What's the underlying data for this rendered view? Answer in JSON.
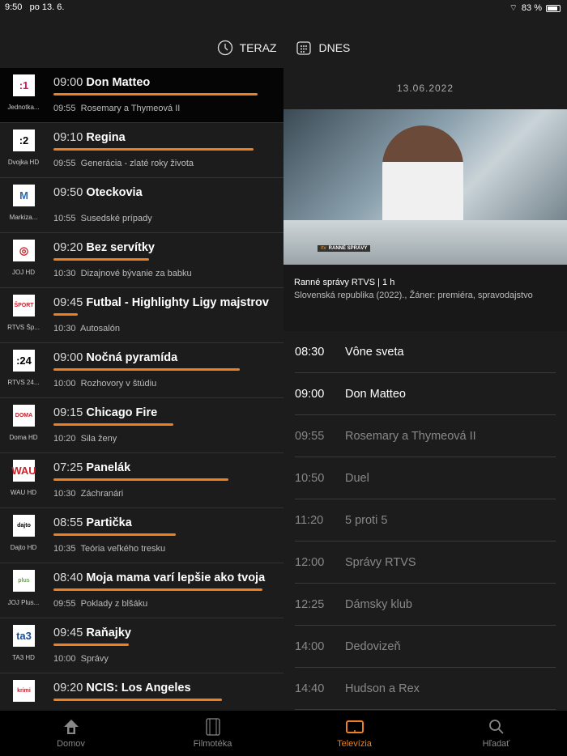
{
  "status": {
    "time": "9:50",
    "date": "po 13. 6.",
    "battery": "83 %",
    "battery_level": 83
  },
  "top": {
    "now_label": "TERAZ",
    "today_label": "DNES"
  },
  "channels": [
    {
      "logo": ":1",
      "name": "Jednotka...",
      "time": "09:00",
      "title": "Don Matteo",
      "progress": 0.92,
      "next_time": "09:55",
      "next_title": "Rosemary a Thymeová II",
      "logo_color": "#d4145a"
    },
    {
      "logo": ":2",
      "name": "Dvojka HD",
      "time": "09:10",
      "title": "Regina",
      "progress": 0.9,
      "next_time": "09:55",
      "next_title": "Generácia - zlaté roky života",
      "logo_color": "#000000"
    },
    {
      "logo": "M",
      "name": "Markiza...",
      "time": "09:50",
      "title": "Oteckovia",
      "progress": 0,
      "next_time": "10:55",
      "next_title": "Susedské prípady",
      "logo_color": "#2a6ab5"
    },
    {
      "logo": "◎",
      "name": "JOJ HD",
      "time": "09:20",
      "title": "Bez servítky",
      "progress": 0.43,
      "next_time": "10:30",
      "next_title": "Dizajnové bývanie za babku",
      "logo_color": "#d0202a"
    },
    {
      "logo": "ŠPORT",
      "name": "RTVS Šp...",
      "time": "09:45",
      "title": "Futbal - Highlighty Ligy majstrov",
      "progress": 0.11,
      "next_time": "10:30",
      "next_title": "Autosalón",
      "logo_color": "#d0202a"
    },
    {
      "logo": ":24",
      "name": "RTVS 24...",
      "time": "09:00",
      "title": "Nočná pyramída",
      "progress": 0.84,
      "next_time": "10:00",
      "next_title": "Rozhovory v štúdiu",
      "logo_color": "#000000"
    },
    {
      "logo": "DOMA",
      "name": "Doma HD",
      "time": "09:15",
      "title": "Chicago Fire",
      "progress": 0.54,
      "next_time": "10:20",
      "next_title": "Sila ženy",
      "logo_color": "#c0202a"
    },
    {
      "logo": "WAU",
      "name": "WAU HD",
      "time": "07:25",
      "title": "Panelák",
      "progress": 0.79,
      "next_time": "10:30",
      "next_title": "Záchranári",
      "logo_color": "#d0202a"
    },
    {
      "logo": "dajto",
      "name": "Dajto HD",
      "time": "08:55",
      "title": "Partička",
      "progress": 0.55,
      "next_time": "10:35",
      "next_title": "Teória veľkého tresku",
      "logo_color": "#000000"
    },
    {
      "logo": "plus",
      "name": "JOJ Plus...",
      "time": "08:40",
      "title": "Moja mama varí lepšie ako tvoja",
      "progress": 0.94,
      "next_time": "09:55",
      "next_title": "Poklady z blšáku",
      "logo_color": "#5cb030"
    },
    {
      "logo": "ta3",
      "name": "TA3 HD",
      "time": "09:45",
      "title": "Raňajky",
      "progress": 0.34,
      "next_time": "10:00",
      "next_title": "Správy",
      "logo_color": "#1a4e9a"
    },
    {
      "logo": "krimi",
      "name": "",
      "time": "09:20",
      "title": "NCIS: Los Angeles",
      "progress": 0.76,
      "next_time": "",
      "next_title": "",
      "logo_color": "#c0202a"
    }
  ],
  "detail": {
    "date": "13.06.2022",
    "video_label": "RANNÉ SPRÁVY",
    "video_brand": "rtv",
    "title": "Ranné správy RTVS | 1 h",
    "desc": "Slovenská republika (2022)., Žáner: premiéra, spravodajstvo"
  },
  "schedule": [
    {
      "time": "08:30",
      "title": "Vône sveta",
      "current": true
    },
    {
      "time": "09:00",
      "title": "Don Matteo",
      "current": true
    },
    {
      "time": "09:55",
      "title": "Rosemary a Thymeová II",
      "current": false
    },
    {
      "time": "10:50",
      "title": "Duel",
      "current": false
    },
    {
      "time": "11:20",
      "title": "5 proti 5",
      "current": false
    },
    {
      "time": "12:00",
      "title": "Správy RTVS",
      "current": false
    },
    {
      "time": "12:25",
      "title": "Dámsky klub",
      "current": false
    },
    {
      "time": "14:00",
      "title": "Dedovizeň",
      "current": false
    },
    {
      "time": "14:40",
      "title": "Hudson a Rex",
      "current": false
    }
  ],
  "tabs": [
    {
      "label": "Domov",
      "icon": "home-icon"
    },
    {
      "label": "Filmotéka",
      "icon": "film-icon"
    },
    {
      "label": "Televízia",
      "icon": "tv-icon",
      "selected": true
    },
    {
      "label": "Hľadať",
      "icon": "search-icon"
    }
  ],
  "colors": {
    "accent": "#f07f1f"
  }
}
